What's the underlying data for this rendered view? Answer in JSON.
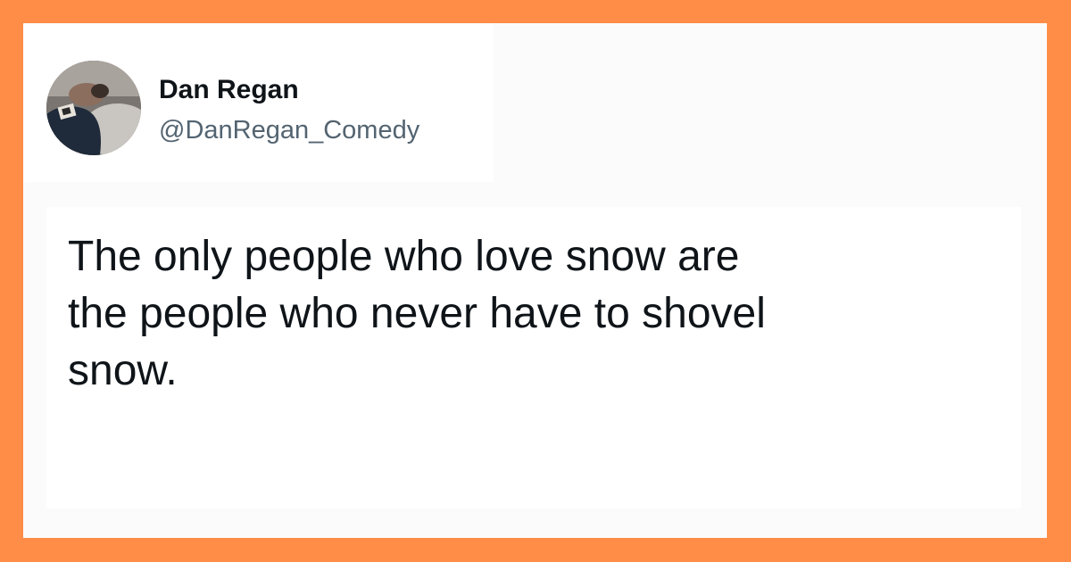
{
  "colors": {
    "frame_border": "#FF8C47",
    "card_background": "#FBFBFB",
    "name_text": "#0F1419",
    "handle_text": "#536471"
  },
  "tweet": {
    "author": {
      "display_name": "Dan Regan",
      "handle": "@DanRegan_Comedy",
      "avatar_icon": "profile-photo"
    },
    "text": "The only people who love snow are\nthe people who never have to shovel\nsnow."
  }
}
